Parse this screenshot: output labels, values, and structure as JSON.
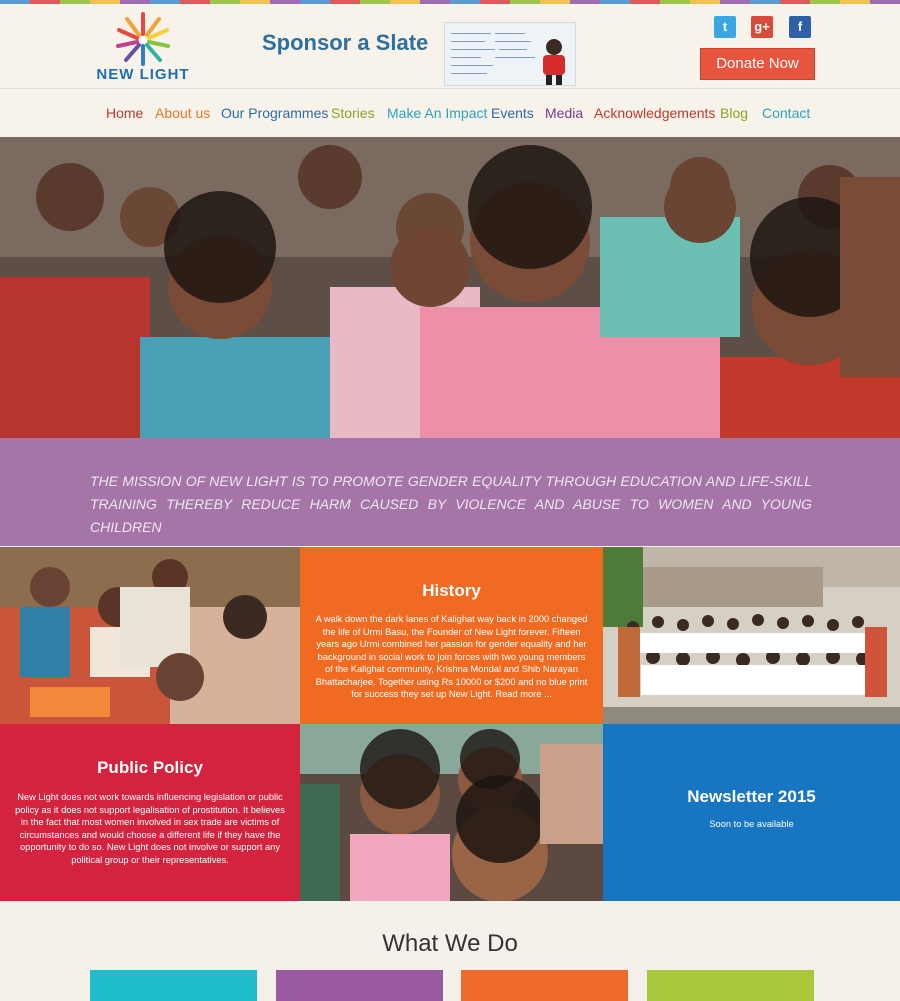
{
  "header": {
    "logo_text": "NEW LIGHT",
    "sponsor_text": "Sponsor a Slate",
    "donate_label": "Donate Now",
    "social": [
      "twitter-icon",
      "google-plus-icon",
      "facebook-icon"
    ]
  },
  "nav": {
    "items": [
      {
        "label": "Home",
        "color": "#c0392b"
      },
      {
        "label": "About us",
        "color": "#e07a2c"
      },
      {
        "label": "Our Programmes",
        "color": "#2f6aa8"
      },
      {
        "label": "Stories",
        "color": "#8aa32a"
      },
      {
        "label": "Make An Impact",
        "color": "#2aa3c0"
      },
      {
        "label": "Events",
        "color": "#2f6aa8"
      },
      {
        "label": "Media",
        "color": "#7a3a86"
      },
      {
        "label": "Acknowledgements",
        "color": "#c0392b"
      },
      {
        "label": "Blog",
        "color": "#8aa32a"
      },
      {
        "label": "Contact",
        "color": "#2aa3c0"
      }
    ]
  },
  "mission": {
    "text": "THE MISSION OF NEW LIGHT IS TO PROMOTE GENDER EQUALITY THROUGH EDUCATION AND LIFE-SKILL TRAINING THEREBY REDUCE HARM CAUSED BY VIOLENCE AND ABUSE TO WOMEN AND YOUNG CHILDREN"
  },
  "history": {
    "title": "History",
    "body": "A walk down the dark lanes of Kalighat way back in 2000 changed the life of Urmi Basu, the Founder of New Light forever. Fifteen years ago Urmi combined her passion for gender equality and her background in social work to join forces with two young members of the Kalighat community, Krishna Mondal and Shib Narayan Bhattacharjee. Together using Rs 10000 or $200 and no blue print for success they set up New Light. Read more ..."
  },
  "policy": {
    "title": "Public Policy",
    "body": "New Light does not work towards influencing legislation or public policy as it does not support legalisation of prostitution. It believes in the fact that most women involved in sex trade are victims of circumstances and would choose a different life if they have the opportunity to do so. New Light does not involve or support any political group or their representatives."
  },
  "newsletter": {
    "title": "Newsletter 2015",
    "subtitle": "Soon to be available"
  },
  "what_we_do": {
    "heading": "What We Do",
    "colors": [
      "#1ebdc9",
      "#9a5aa0",
      "#ef6b2d",
      "#a8c83a"
    ]
  },
  "colors": {
    "history_bg": "#f06a22",
    "policy_bg": "#d3233f",
    "newsletter_bg": "#1775c2",
    "mission_bg": "#a575a8",
    "donate_bg": "#e8553f"
  }
}
